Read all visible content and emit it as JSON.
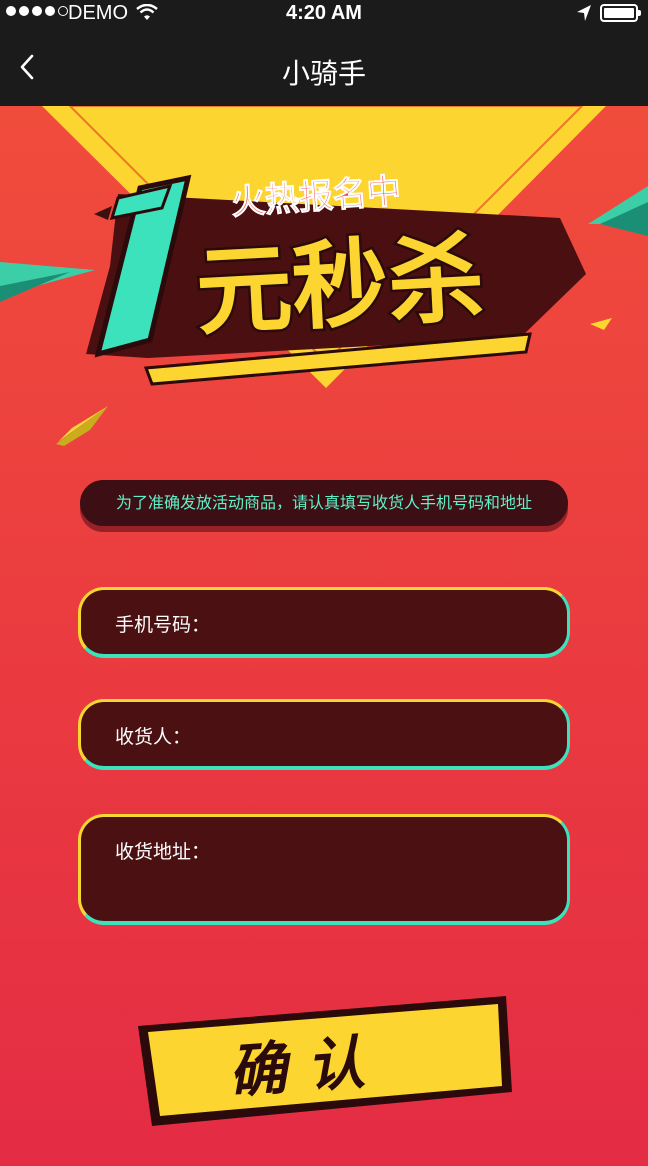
{
  "status_bar": {
    "carrier": "DEMO",
    "time": "4:20 AM"
  },
  "nav": {
    "title": "小骑手",
    "back_icon": "chevron-left-icon"
  },
  "banner": {
    "tagline": "火热报名中",
    "number": "1",
    "headline": "元秒杀",
    "colors": {
      "yellow": "#f9d632",
      "teal": "#3ce2bb",
      "red": "#e8433f"
    }
  },
  "hint": {
    "text": "为了准确发放活动商品，请认真填写收货人手机号码和地址"
  },
  "form": {
    "phone_label": "手机号码：",
    "name_label": "收货人：",
    "address_label": "收货地址："
  },
  "confirm_button": {
    "label": "确 认"
  }
}
